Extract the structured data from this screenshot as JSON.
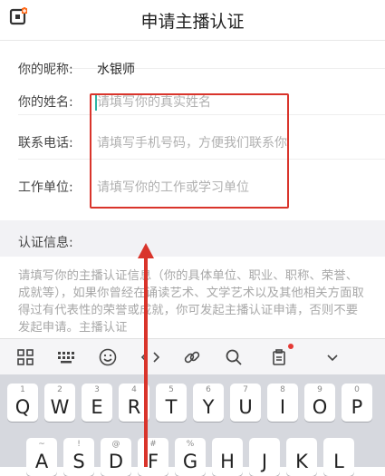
{
  "header": {
    "title": "申请主播认证",
    "back_icon": "back-logo-icon"
  },
  "form": {
    "nickname_label": "你的昵称:",
    "nickname_value": "水银师",
    "name_label": "你的姓名:",
    "name_placeholder": "请填写你的真实姓名",
    "phone_label": "联系电话:",
    "phone_placeholder": "请填写手机号码，方便我们联系你",
    "work_label": "工作单位:",
    "work_placeholder": "请填写你的工作或学习单位"
  },
  "section": {
    "label": "认证信息:"
  },
  "description": "请填写你的主播认证信息（你的具体单位、职业、职称、荣誉、成就等），如果你曾经在诵读艺术、文学艺术以及其他相关方面取得过有代表性的荣誉或成就，你可发起主播认证申请，否则不要发起申请。主播认证",
  "toolbar": {
    "icons": [
      "grid-icon",
      "keyboard-icon",
      "emoji-icon",
      "code-icon",
      "link-icon",
      "search-icon",
      "clipboard-icon",
      "chevron-down-icon"
    ]
  },
  "keyboard": {
    "row1": [
      {
        "num": "1",
        "ch": "Q"
      },
      {
        "num": "2",
        "ch": "W"
      },
      {
        "num": "3",
        "ch": "E"
      },
      {
        "num": "4",
        "ch": "R"
      },
      {
        "num": "5",
        "ch": "T"
      },
      {
        "num": "6",
        "ch": "Y"
      },
      {
        "num": "7",
        "ch": "U"
      },
      {
        "num": "8",
        "ch": "I"
      },
      {
        "num": "9",
        "ch": "O"
      },
      {
        "num": "0",
        "ch": "P"
      }
    ],
    "row2": [
      {
        "num": "~",
        "ch": "A"
      },
      {
        "num": "!",
        "ch": "S"
      },
      {
        "num": "@",
        "ch": "D"
      },
      {
        "num": "#",
        "ch": "F"
      },
      {
        "num": "%",
        "ch": "G"
      },
      {
        "num": "",
        "ch": "H"
      },
      {
        "num": "",
        "ch": "J"
      },
      {
        "num": "",
        "ch": "K"
      },
      {
        "num": "",
        "ch": "L"
      }
    ]
  },
  "colors": {
    "annotation": "#d9342b",
    "cursor": "#2db4a5"
  }
}
